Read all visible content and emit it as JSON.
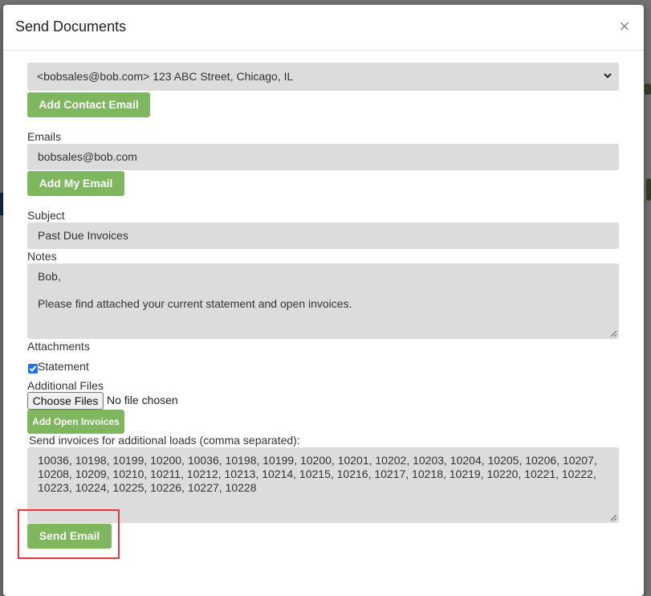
{
  "modal": {
    "title": "Send Documents",
    "close_label": "×"
  },
  "contact_select": {
    "selected": "<bobsales@bob.com> 123 ABC Street, Chicago, IL"
  },
  "buttons": {
    "add_contact_email": "Add Contact Email",
    "add_my_email": "Add My Email",
    "add_open_invoices": "Add Open Invoices",
    "send_email": "Send Email"
  },
  "emails": {
    "label": "Emails",
    "value": "bobsales@bob.com"
  },
  "subject": {
    "label": "Subject",
    "value": "Past Due Invoices"
  },
  "notes": {
    "label": "Notes",
    "line1": "Bob,",
    "line2": "Please find attached your current statement and open invoices."
  },
  "attachments": {
    "label": "Attachments",
    "statement_label": "Statement",
    "statement_checked": true
  },
  "additional_files": {
    "label": "Additional Files",
    "choose_label": "Choose Files",
    "status": "No file chosen"
  },
  "additional_loads": {
    "label": "Send invoices for additional loads (comma separated):",
    "line1": "10036, 10198, 10199, 10200, 10036, 10198, 10199, 10200, 10201, 10202, 10203, 10204, 10205, 10206, 10207,",
    "line2": "10208, 10209, 10210, 10211, 10212, 10213, 10214, 10215, 10216, 10217, 10218, 10219, 10220, 10221, 10222,",
    "line3": "10223, 10224, 10225, 10226, 10227, 10228"
  },
  "colors": {
    "button_green": "#7eb75e",
    "input_gray": "#dcdcdc",
    "highlight_red": "#e53935",
    "checkbox_blue": "#1a73e8"
  }
}
